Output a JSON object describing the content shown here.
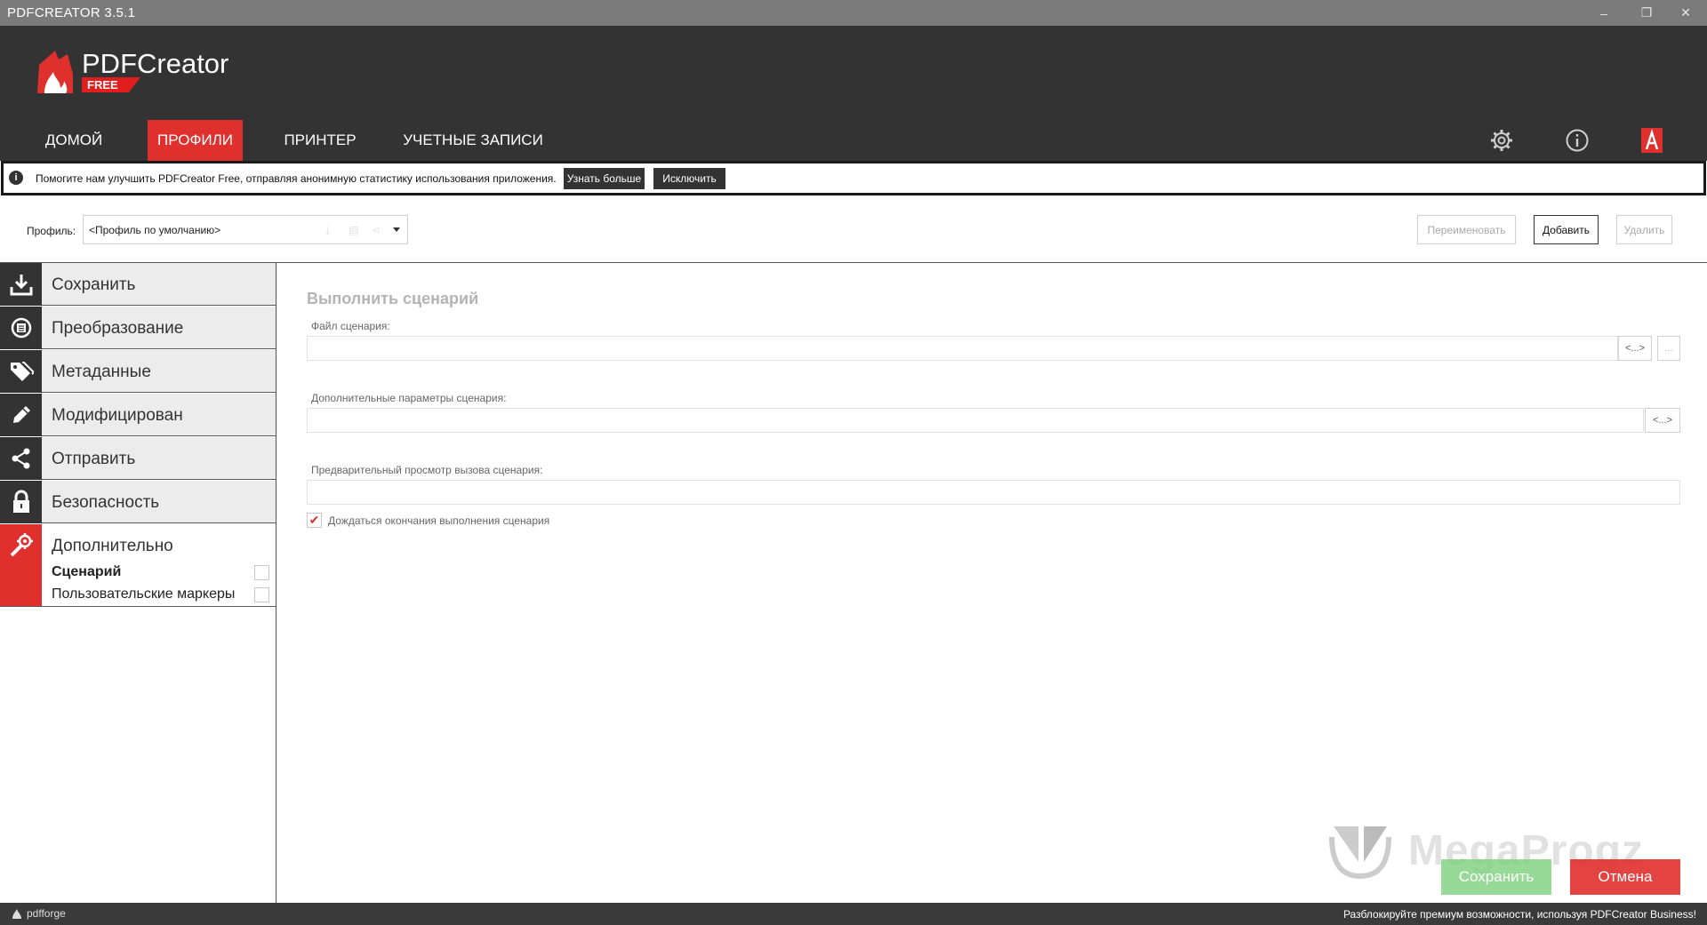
{
  "window": {
    "title": "PDFCREATOR 3.5.1",
    "controls": {
      "minimize_icon": "–",
      "restore_icon": "❐",
      "close_icon": "✕"
    }
  },
  "header": {
    "brand": "PDFCreator",
    "edition": "FREE",
    "nav": [
      {
        "label": "ДОМОЙ",
        "active": false
      },
      {
        "label": "ПРОФИЛИ",
        "active": true
      },
      {
        "label": "ПРИНТЕР",
        "active": false
      },
      {
        "label": "УЧЕТНЫЕ ЗАПИСИ",
        "active": false
      }
    ],
    "icons": [
      "gear-icon",
      "info-icon",
      "pdf-architect-icon"
    ]
  },
  "infobar": {
    "message": "Помогите нам улучшить PDFCreator Free, отправляя анонимную статистику использования приложения.",
    "learn_more": "Узнать больше",
    "exclude": "Исключить"
  },
  "profile": {
    "label": "Профиль:",
    "selected": "<Профиль по умолчанию>",
    "rename": "Переименовать",
    "add": "Добавить",
    "delete": "Удалить"
  },
  "sidebar": {
    "items": [
      {
        "label": "Сохранить",
        "icon": "download-icon"
      },
      {
        "label": "Преобразование",
        "icon": "convert-icon"
      },
      {
        "label": "Метаданные",
        "icon": "tags-icon"
      },
      {
        "label": "Модифицирован",
        "icon": "pencil-icon"
      },
      {
        "label": "Отправить",
        "icon": "share-icon"
      },
      {
        "label": "Безопасность",
        "icon": "lock-icon"
      },
      {
        "label": "Дополнительно",
        "icon": "wrench-gear-icon",
        "active": true
      }
    ],
    "subitems": [
      {
        "label": "Сценарий",
        "checked": false,
        "selected": true
      },
      {
        "label": "Пользовательские маркеры",
        "checked": false,
        "selected": false
      }
    ]
  },
  "content": {
    "title": "Выполнить сценарий",
    "script_file_label": "Файл сценария:",
    "script_file_value": "",
    "token_button": "<...>",
    "browse_button": "...",
    "extra_params_label": "Дополнительные параметры сценария:",
    "extra_params_value": "",
    "preview_label": "Предварительный просмотр вызова сценария:",
    "preview_value": "",
    "wait_checkbox_label": "Дождаться окончания выполнения сценария",
    "wait_checked": true
  },
  "actions": {
    "save": "Сохранить",
    "cancel": "Отмена"
  },
  "watermark": "MegaProgz",
  "footer": {
    "vendor": "pdfforge",
    "promo": "Разблокируйте премиум возможности, используя PDFCreator Business!"
  },
  "colors": {
    "accent": "#e0302e",
    "header_bg": "#333333",
    "save_green": "#7ed07e",
    "cancel_red": "#e0302e"
  }
}
